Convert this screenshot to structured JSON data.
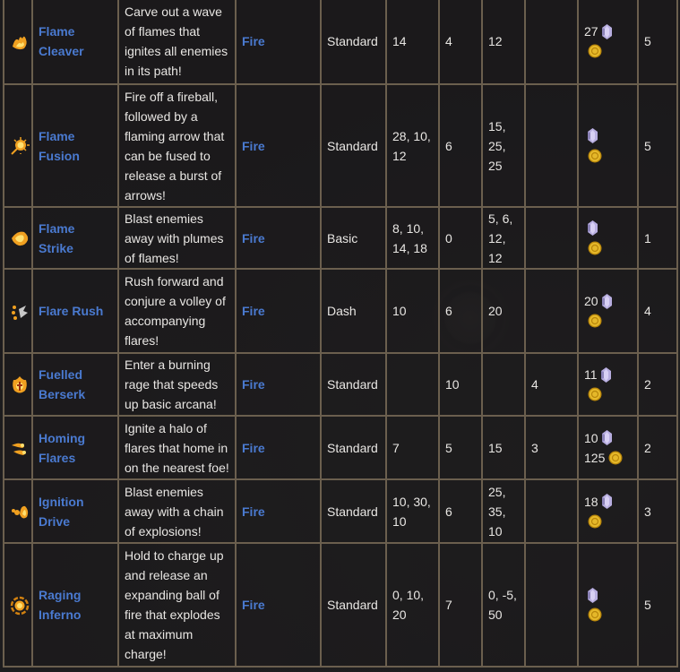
{
  "colors": {
    "link": "#4a7ad0",
    "border": "#6b5f4e",
    "background": "#1b1a1c",
    "text": "#e8e6e3",
    "gem": "#b8aee0",
    "coin": "#e5b82a"
  },
  "rows": [
    {
      "icon": "flame-cleaver-icon",
      "name": "Flame Cleaver",
      "description": "Carve out a wave of flames that ignites all enemies in its path!",
      "element": "Fire",
      "type": "Standard",
      "damage": "14",
      "cooldown": "4",
      "knockback": "12",
      "extra": "",
      "cost_gems": "27",
      "cost_gold": "",
      "tier": "5"
    },
    {
      "icon": "flame-fusion-icon",
      "name": "Flame Fusion",
      "description": "Fire off a fireball, followed by a flaming arrow that can be fused to release a burst of arrows!",
      "element": "Fire",
      "type": "Standard",
      "damage": "28, 10, 12",
      "cooldown": "6",
      "knockback": "15, 25, 25",
      "extra": "",
      "cost_gems": "",
      "cost_gold": "",
      "tier": "5"
    },
    {
      "icon": "flame-strike-icon",
      "name": "Flame Strike",
      "description": "Blast enemies away with plumes of flames!",
      "element": "Fire",
      "type": "Basic",
      "damage": "8, 10, 14, 18",
      "cooldown": "0",
      "knockback": "5, 6, 12, 12",
      "extra": "",
      "cost_gems": "",
      "cost_gold": "",
      "tier": "1"
    },
    {
      "icon": "flare-rush-icon",
      "name": "Flare Rush",
      "description": "Rush forward and conjure a volley of accompanying flares!",
      "element": "Fire",
      "type": "Dash",
      "damage": "10",
      "cooldown": "6",
      "knockback": "20",
      "extra": "",
      "cost_gems": "20",
      "cost_gold": "",
      "tier": "4"
    },
    {
      "icon": "fuelled-berserk-icon",
      "name": "Fuelled Berserk",
      "description": "Enter a burning rage that speeds up basic arcana!",
      "element": "Fire",
      "type": "Standard",
      "damage": "",
      "cooldown": "10",
      "knockback": "",
      "extra": "4",
      "cost_gems": "11",
      "cost_gold": "",
      "tier": "2"
    },
    {
      "icon": "homing-flares-icon",
      "name": "Homing Flares",
      "description": "Ignite a halo of flares that home in on the nearest foe!",
      "element": "Fire",
      "type": "Standard",
      "damage": "7",
      "cooldown": "5",
      "knockback": "15",
      "extra": "3",
      "cost_gems": "10",
      "cost_gold": "125",
      "tier": "2"
    },
    {
      "icon": "ignition-drive-icon",
      "name": "Ignition Drive",
      "description": "Blast enemies away with a chain of explosions!",
      "element": "Fire",
      "type": "Standard",
      "damage": "10, 30, 10",
      "cooldown": "6",
      "knockback": "25, 35, 10",
      "extra": "",
      "cost_gems": "18",
      "cost_gold": "",
      "tier": "3"
    },
    {
      "icon": "raging-inferno-icon",
      "name": "Raging Inferno",
      "description": "Hold to charge up and release an expanding ball of fire that explodes at maximum charge!",
      "element": "Fire",
      "type": "Standard",
      "damage": "0, 10, 20",
      "cooldown": "7",
      "knockback": "0, -5, 50",
      "extra": "",
      "cost_gems": "",
      "cost_gold": "",
      "tier": "5"
    }
  ]
}
